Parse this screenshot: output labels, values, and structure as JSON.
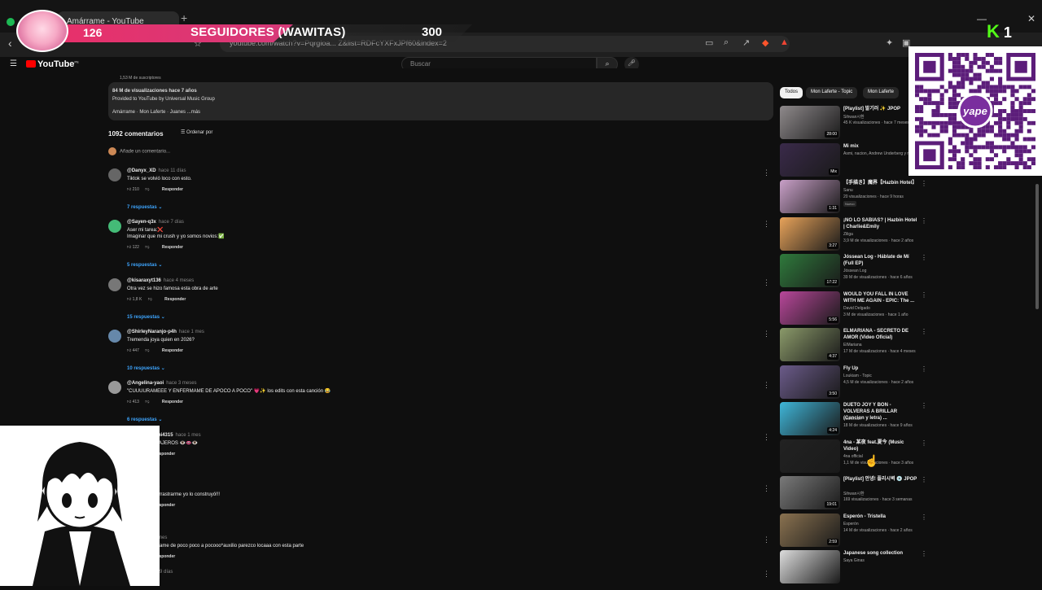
{
  "browser": {
    "tab_title": "Amárrame - YouTube",
    "url": "youtube.com/watch?v=Pqrgloa... Z&list=RDFcYXFxJPf60&index=2"
  },
  "youtube": {
    "logo": "YouTube",
    "logo_region": "PE",
    "search_placeholder": "Buscar",
    "description": {
      "subscribers": "1,53 M de suscriptores",
      "views_line": "84 M de visualizaciones  hace 7 años",
      "provided": "Provided to YouTube by Universal Music Group",
      "credits": "Amárrame · Mon Laferte · Juanes ...más"
    },
    "comments_count": "1092 comentarios",
    "sort_label": "Ordenar por",
    "add_comment": "Añade un comentario...",
    "comments": [
      {
        "user": "@Danyx_XD",
        "time": "hace 11 días",
        "text": "Tiktok se volvió loco con esto.",
        "likes": "210",
        "reply": "Responder",
        "replies": "7 respuestas"
      },
      {
        "user": "@Sayen-q3x",
        "time": "hace 7 días",
        "text": "Aser mi tarea:❌\nImaginar que mi crush y yo somos novios:✅",
        "likes": "122",
        "reply": "Responder",
        "replies": "5 respuestas"
      },
      {
        "user": "@kisaraxyt136",
        "time": "hace 4 meses",
        "text": "Otra vez se hizo famosa esta obra de arte",
        "likes": "1,8 K",
        "reply": "Responder",
        "replies": "15 respuestas"
      },
      {
        "user": "@ShirleyNaranjo-p4h",
        "time": "hace 1 mes",
        "text": "Tremenda joya quien en 2026?",
        "likes": "447",
        "reply": "Responder",
        "replies": "10 respuestas"
      },
      {
        "user": "@Angelina-yaoi",
        "time": "hace 3 meses",
        "text": "\"CUUUURAMEEE Y ENFERMAME DE APOCO A POCO\" 💗✨ los edits con esta canción 😂",
        "likes": "413",
        "reply": "Responder",
        "replies": "6 respuestas"
      },
      {
        "user": "@pallomoreani4315",
        "time": "hace 1 mes",
        "text": "...TAMOS MIGAJEROS 👁️👄👁️",
        "likes": "",
        "reply": "Responder",
        "replies": ""
      },
      {
        "user": "",
        "time": "hace 4 meses",
        "text": "...s piso para arrastrarme yo lo construyó!!!",
        "likes": "",
        "reply": "Responder",
        "replies": ""
      },
      {
        "user": "...atia",
        "time": "hace 1 mes",
        "text": "...eee y enfermame de poco poco a pocooo*auxilio parezco locaaa con esta parte",
        "likes": "",
        "reply": "Responder",
        "replies": ""
      },
      {
        "user": "...k3o4b",
        "time": "hace 9 días",
        "text": "",
        "likes": "",
        "reply": "",
        "replies": ""
      }
    ],
    "chips": [
      "Todos",
      "Mon Laferte - Topic",
      "Mon Laferte"
    ],
    "sidebar": [
      {
        "title": "[Playlist] 발기러 ✨ JPOP",
        "channel": "Sihwan시환",
        "meta": "45 K visualizaciones · hace 7 meses",
        "dur": "28:00",
        "color": "#8f8a8c"
      },
      {
        "title": "Mi mix",
        "channel": "Asmi, nacion, Andrew Underberg y más",
        "meta": "",
        "dur": "Mix",
        "color": "#3a2a4a"
      },
      {
        "title": "【手描き】魔界【Hazbin Hotel】",
        "channel": "Sanu",
        "meta": "20 visualizaciones · hace 9 horas",
        "badge": "Nuevo",
        "dur": "1:31",
        "color": "#c9a0c8"
      },
      {
        "title": "¡NO LO SABIAS? | Hazbin Hotel | Charlie&Emily",
        "channel": "Ziliga",
        "meta": "3,9 M de visualizaciones · hace 2 años",
        "dur": "3:27",
        "color": "#e8a35a"
      },
      {
        "title": "Jóssean Log - Háblate de Mí (Full EP)",
        "channel": "Jóssean Log",
        "meta": "39 M de visualizaciones · hace 6 años",
        "dur": "17:22",
        "color": "#2f7a3c"
      },
      {
        "title": "WOULD YOU FALL IN LOVE WITH ME AGAIN - EPIC: The ...",
        "channel": "David Delgado",
        "meta": "3 M de visualizaciones · hace 1 año",
        "dur": "5:56",
        "color": "#b8479a"
      },
      {
        "title": "ELMARIANA - SECRETO DE AMOR (Video Oficial)",
        "channel": "ElMariana",
        "meta": "17 M de visualizaciones · hace 4 meses",
        "dur": "4:37",
        "color": "#8b9a6a"
      },
      {
        "title": "Fly Up",
        "channel": "Loukiam - Topic",
        "meta": "4,5 M de visualizaciones · hace 2 años",
        "dur": "3:50",
        "color": "#6b5b8a"
      },
      {
        "title": "DUETO JOY Y BON - VOLVERAS A BRILLAR (Cancion y letra) ...",
        "channel": "eddochan",
        "meta": "18 M de visualizaciones · hace 9 años",
        "dur": "4:24",
        "color": "#3fb6d9"
      },
      {
        "title": "4na - 某夜 feat.夏今 (Music Video)",
        "channel": "4na official",
        "meta": "1,1 M de visualizaciones · hace 3 años",
        "dur": "",
        "color": "#222222"
      },
      {
        "title": "[Playlist] 안녕! 플리시벽 💿 JPOP",
        "channel": "Sihwan시환",
        "meta": "169 visualizaciones · hace 3 semanas",
        "dur": "19:01",
        "color": "#7a7a7a"
      },
      {
        "title": "Esperón - Tristella",
        "channel": "Esperón",
        "meta": "14 M de visualizaciones · hace 2 años",
        "dur": "2:59",
        "color": "#8a7250"
      },
      {
        "title": "Japanese song collection",
        "channel": "Saya Ginas",
        "meta": "",
        "dur": "",
        "color": "#ddd"
      }
    ]
  },
  "overlay": {
    "count": "126",
    "label": "SEGUIDORES (WAWITAS)",
    "goal": "300",
    "k_number": "1",
    "qr_brand": "yape"
  }
}
